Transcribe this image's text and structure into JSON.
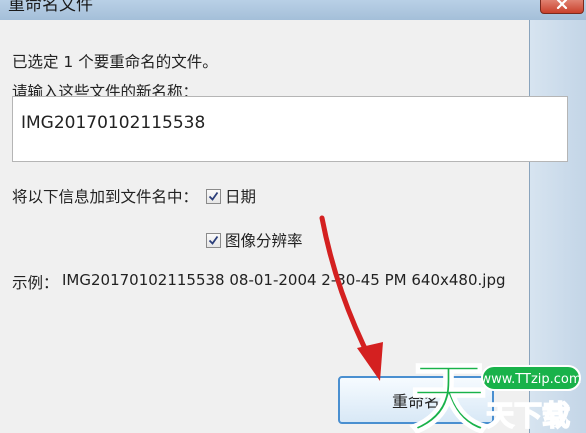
{
  "window": {
    "title": "重命名文件"
  },
  "dialog": {
    "selected_info": "已选定 1 个要重命名的文件。",
    "input_prompt": "请输入这些文件的新名称：",
    "new_name_value": "IMG20170102115538",
    "append_label": "将以下信息加到文件名中：",
    "option_date": {
      "label": "日期",
      "checked": true
    },
    "option_resolution": {
      "label": "图像分辨率",
      "checked": true
    },
    "example_label": "示例：",
    "example_value": "IMG20170102115538 08-01-2004 2-30-45 PM 640x480.jpg",
    "rename_button": "重命名"
  },
  "annotation": {
    "arrow_color": "#d42020"
  },
  "watermark": {
    "url_text": "www.TTzip.com",
    "brand_text": "天下载",
    "big_char": "天",
    "color": "#19b24a"
  }
}
